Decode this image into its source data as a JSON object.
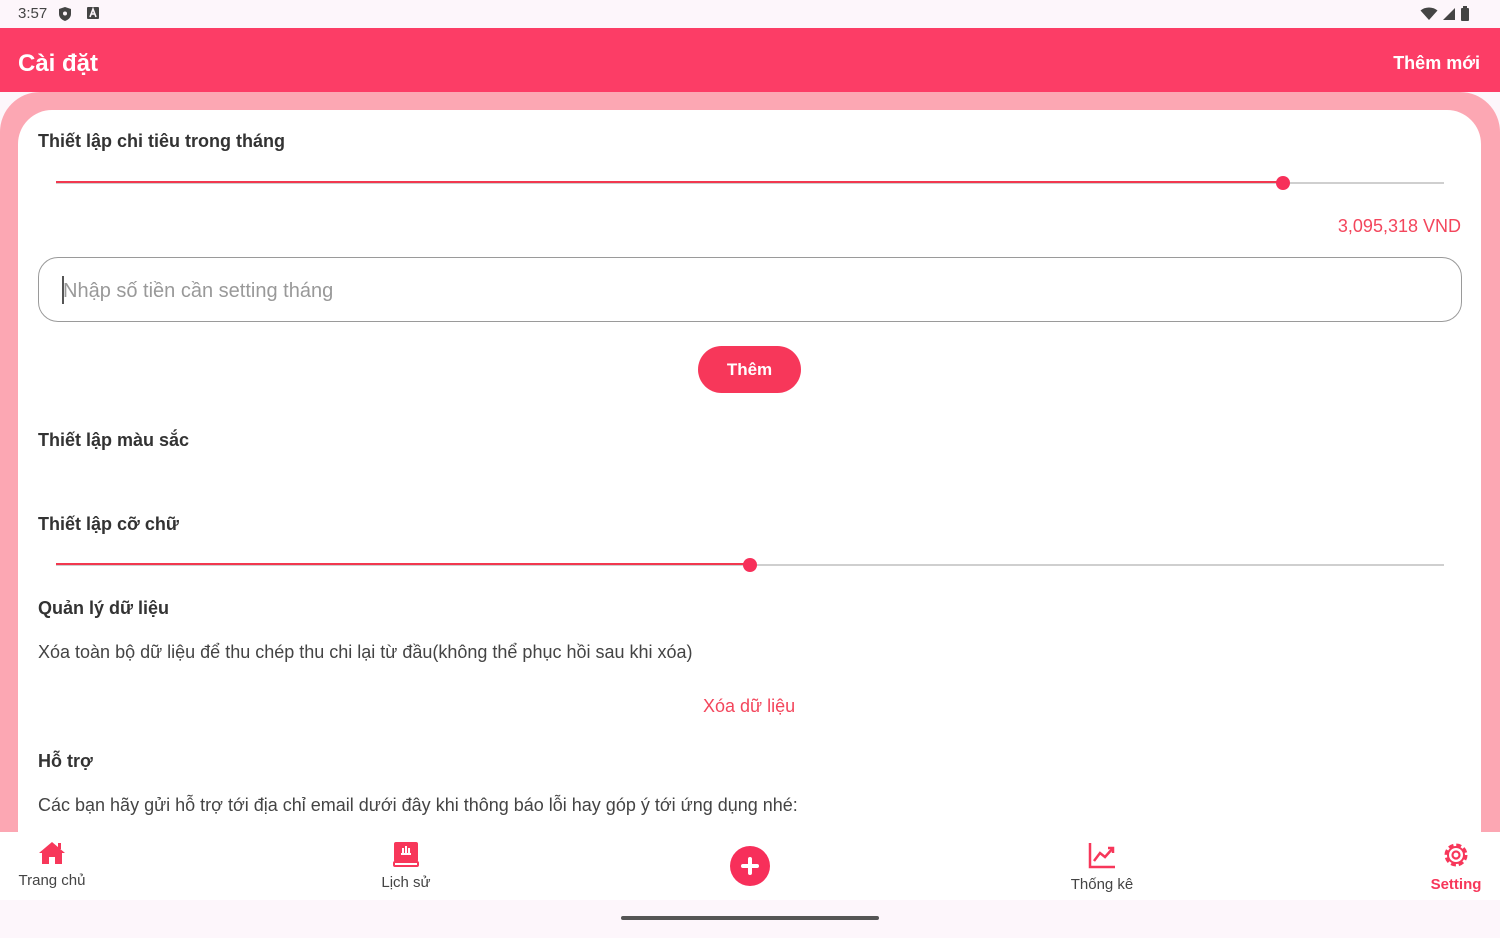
{
  "status_bar": {
    "time": "3:57",
    "icons": [
      "shield-icon",
      "a-icon",
      "wifi-icon",
      "signal-icon",
      "battery-icon"
    ]
  },
  "app_bar": {
    "title": "Cài đặt",
    "action_label": "Thêm mới"
  },
  "monthly_spending": {
    "title": "Thiết lập chi tiêu trong tháng",
    "slider_fraction": 0.884,
    "amount_text": "3,095,318 VND",
    "input_placeholder": "Nhập số tiền cần setting tháng",
    "add_button_label": "Thêm"
  },
  "color_settings": {
    "title": "Thiết lập màu sắc"
  },
  "font_size_settings": {
    "title": "Thiết lập cỡ chữ",
    "slider_fraction": 0.5
  },
  "data_management": {
    "title": "Quản lý dữ liệu",
    "description": "Xóa toàn bộ dữ liệu để thu chép thu chi lại từ đầu(không thể phục hồi sau khi xóa)",
    "delete_link": "Xóa dữ liệu"
  },
  "support": {
    "title": "Hỗ trợ",
    "description": "Các bạn hãy gửi hỗ trợ tới địa chỉ email dưới đây khi thông báo lỗi hay góp ý tới ứng dụng nhé:"
  },
  "bottom_nav": {
    "items": [
      {
        "label": "Trang chủ",
        "icon": "home-icon"
      },
      {
        "label": "Lịch sử",
        "icon": "history-icon"
      },
      {
        "label": "",
        "icon": "add-icon"
      },
      {
        "label": "Thống kê",
        "icon": "chart-icon"
      },
      {
        "label": "Setting",
        "icon": "gear-icon",
        "active": true
      }
    ]
  },
  "colors": {
    "primary": "#fc3d66",
    "accent_soft": "#fca7b3",
    "accent_text": "#f3465c",
    "background": "#fdf6fb"
  }
}
